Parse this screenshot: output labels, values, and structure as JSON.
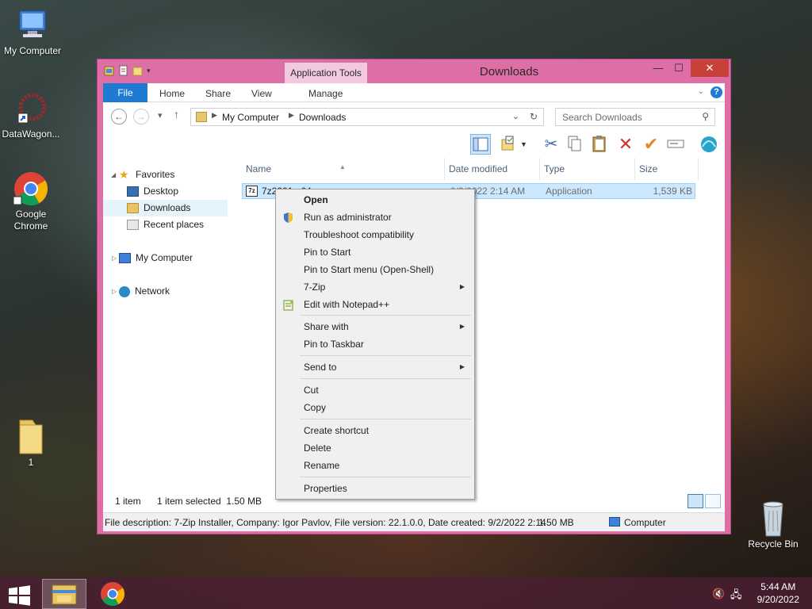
{
  "desktop": {
    "icons": [
      {
        "label": "My Computer"
      },
      {
        "label": "DataWagon..."
      },
      {
        "label": "Google Chrome"
      },
      {
        "label": "1"
      },
      {
        "label": "Recycle Bin"
      }
    ]
  },
  "window": {
    "title": "Downloads",
    "contextual_tab": "Application Tools",
    "close_symbol": "✕",
    "min_symbol": "—",
    "max_symbol": "☐",
    "ribbon_tabs": {
      "file": "File",
      "home": "Home",
      "share": "Share",
      "view": "View",
      "manage": "Manage"
    },
    "help_symbol": "?"
  },
  "nav": {
    "breadcrumb": [
      "My Computer",
      "Downloads"
    ],
    "search_placeholder": "Search Downloads"
  },
  "navpane": {
    "favorites": "Favorites",
    "desktop": "Desktop",
    "downloads": "Downloads",
    "recent": "Recent places",
    "computer": "My Computer",
    "network": "Network"
  },
  "filelist": {
    "columns": {
      "name": "Name",
      "date": "Date modified",
      "type": "Type",
      "size": "Size"
    },
    "rows": [
      {
        "name": "7z2201-x64",
        "date": "9/2/2022 2:14 AM",
        "type": "Application",
        "size": "1,539 KB"
      }
    ]
  },
  "status": {
    "count": "1 item",
    "selection": "1 item selected  1.50 MB",
    "description": "File description: 7-Zip Installer, Company: Igor Pavlov, File version: 22.1.0.0, Date created: 9/2/2022 2:14",
    "size": "1.50 MB",
    "location": "Computer"
  },
  "context_menu": {
    "open": "Open",
    "run_admin": "Run as administrator",
    "troubleshoot": "Troubleshoot compatibility",
    "pin_start": "Pin to Start",
    "pin_start_menu": "Pin to Start menu (Open-Shell)",
    "sevenzip": "7-Zip",
    "notepadpp": "Edit with Notepad++",
    "share_with": "Share with",
    "pin_taskbar": "Pin to Taskbar",
    "send_to": "Send to",
    "cut": "Cut",
    "copy": "Copy",
    "create_shortcut": "Create shortcut",
    "delete": "Delete",
    "rename": "Rename",
    "properties": "Properties",
    "submenu_arrow": "▶"
  },
  "taskbar": {
    "time": "5:44 AM",
    "date": "9/20/2022"
  },
  "colors": {
    "window_frame": "#dd6ea6",
    "file_tab": "#1e7bd1",
    "selection": "#cce8ff",
    "close": "#c7403a"
  }
}
